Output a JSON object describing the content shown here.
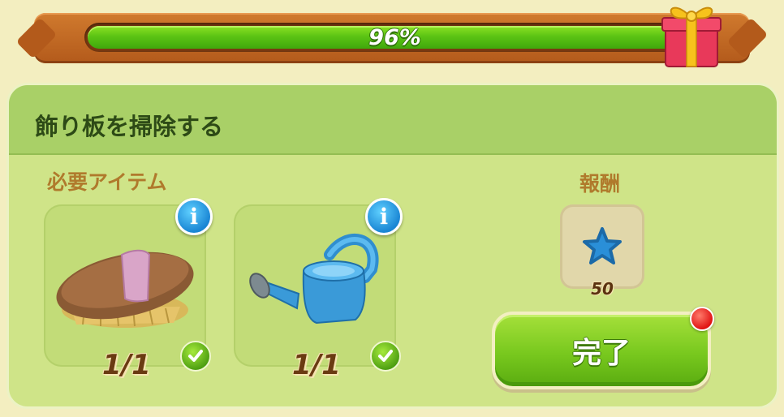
{
  "progress": {
    "value": 0.96,
    "label": "96%"
  },
  "task": {
    "title": "飾り板を掃除する"
  },
  "required": {
    "label": "必要アイテム",
    "items": [
      {
        "name": "brush",
        "icon": "brush-icon",
        "count": "1/1",
        "complete": true
      },
      {
        "name": "watering-can",
        "icon": "watering-can-icon",
        "count": "1/1",
        "complete": true
      }
    ]
  },
  "reward": {
    "label": "報酬",
    "icon": "star-icon",
    "amount": "50"
  },
  "complete_button": {
    "label": "完了"
  },
  "colors": {
    "progress_fill": "#5cc414",
    "frame": "#b35a1b",
    "panel": "#cfe488",
    "button": "#78c81e",
    "star": "#2a8fd8",
    "notification": "#e01414"
  }
}
